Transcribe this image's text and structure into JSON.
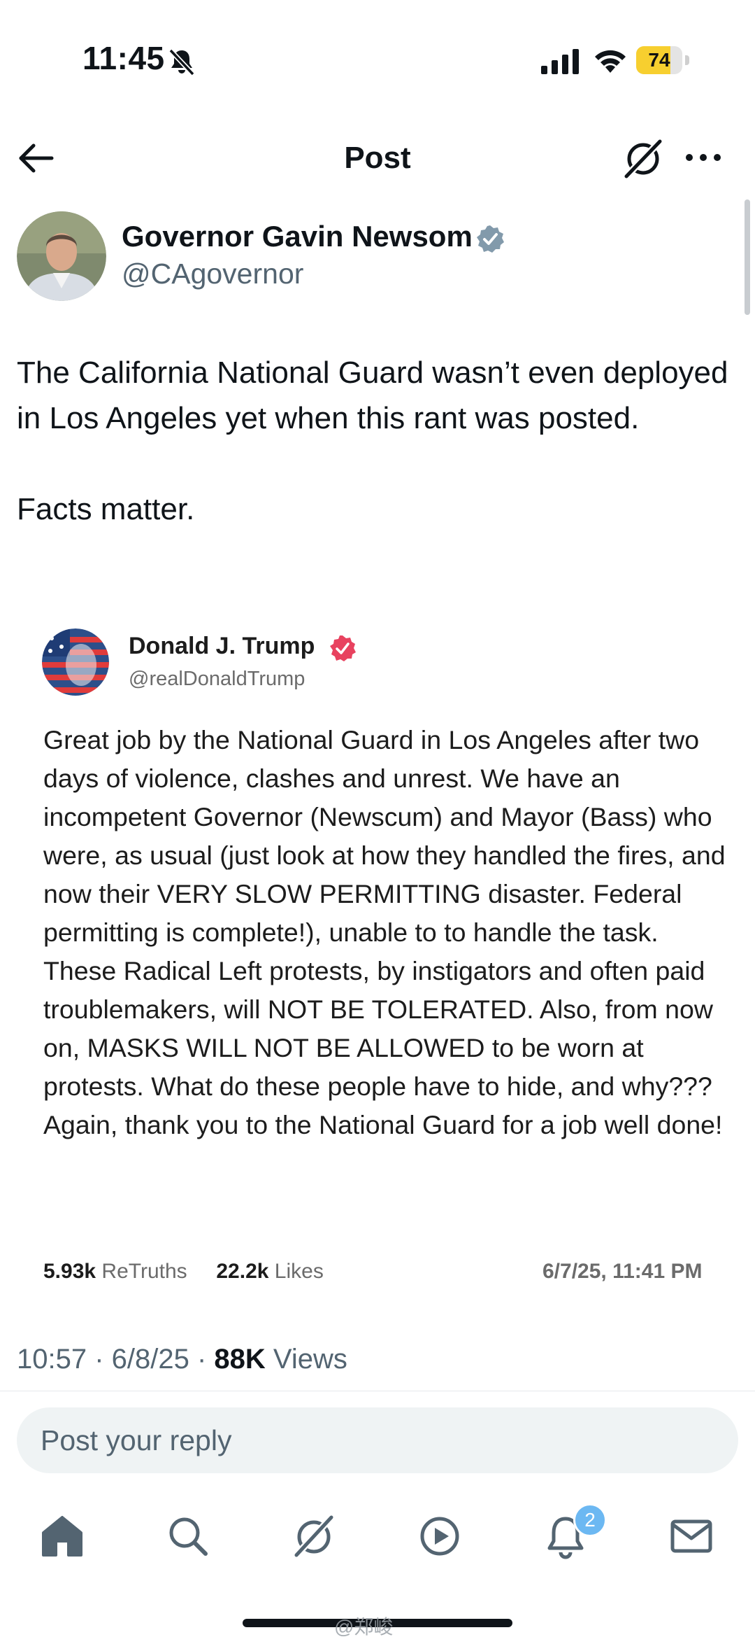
{
  "status_bar": {
    "time": "11:45",
    "battery": "74",
    "battery_level": 0.74,
    "icons": [
      "bell-slash-icon",
      "cellular-signal-icon",
      "wifi-icon",
      "battery-icon"
    ]
  },
  "header": {
    "title": "Post",
    "icons": [
      "back-arrow-icon",
      "grok-icon",
      "more-icon"
    ]
  },
  "post": {
    "author_name": "Governor Gavin Newsom",
    "author_handle": "@CAgovernor",
    "text_line1": "The California National Guard wasn’t even deployed in Los Angeles yet when this rant was posted.",
    "text_line2": "Facts matter."
  },
  "embedded": {
    "name": "Donald J. Trump",
    "handle": "@realDonaldTrump",
    "text": "Great job by the National Guard in Los Angeles after two days of violence, clashes and unrest. We have an incompetent Governor (Newscum) and Mayor (Bass) who were, as usual (just look at how they handled the fires, and now their VERY SLOW PERMITTING disaster. Federal permitting is complete!), unable to to handle the task. These Radical Left protests, by instigators and often paid troublemakers, will NOT BE TOLERATED. Also, from now on, MASKS WILL NOT BE ALLOWED to be worn at protests. What do these people have to hide, and why??? Again, thank you to the National Guard for a job well done!",
    "retruths_count": "5.93k",
    "retruths_label": "ReTruths",
    "likes_count": "22.2k",
    "likes_label": "Likes",
    "date": "6/7/25, 11:41 PM"
  },
  "meta": {
    "time": "10:57",
    "sep1": " · ",
    "date": "6/8/25",
    "sep2": " · ",
    "views_count": "88K",
    "views_label": " Views"
  },
  "reply": {
    "placeholder": "Post your reply"
  },
  "tab_bar": {
    "items": [
      "home-icon",
      "search-icon",
      "grok-icon",
      "video-icon",
      "notifications-icon",
      "messages-icon"
    ],
    "notification_badge": "2"
  },
  "watermark": "@郑峻",
  "colors": {
    "verified_blue": "#829aab",
    "truth_badge": "#e8425f",
    "badge_blue": "#6cb8f2",
    "muted_text": "#536471"
  }
}
